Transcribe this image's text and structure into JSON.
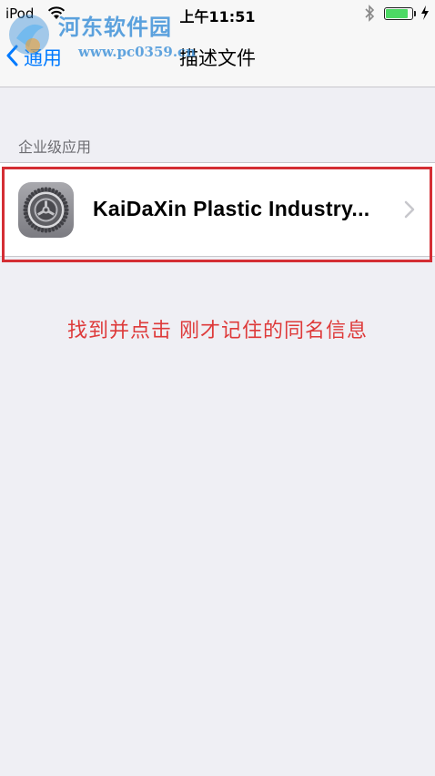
{
  "status_bar": {
    "carrier": "iPod",
    "time": "上午11:51",
    "battery_level": 0.85,
    "icons": [
      "wifi-icon",
      "bluetooth-icon",
      "battery-icon",
      "charging-bolt-icon"
    ]
  },
  "nav": {
    "back_label": "通用",
    "title": "描述文件",
    "icons": [
      "back-chevron-icon"
    ]
  },
  "section": {
    "header": "企业级应用",
    "items": [
      {
        "label": "KaiDaXin Plastic Industry...",
        "icon": "settings-gear-icon"
      }
    ]
  },
  "annotation": {
    "text": "找到并点击 刚才记住的同名信息",
    "color": "#de3a3a"
  },
  "watermark": {
    "title": "河东软件园",
    "url": "www.pc0359.cn"
  },
  "colors": {
    "accent": "#007aff",
    "highlight": "#d42e34",
    "background": "#efeff4",
    "battery": "#4cd964"
  }
}
